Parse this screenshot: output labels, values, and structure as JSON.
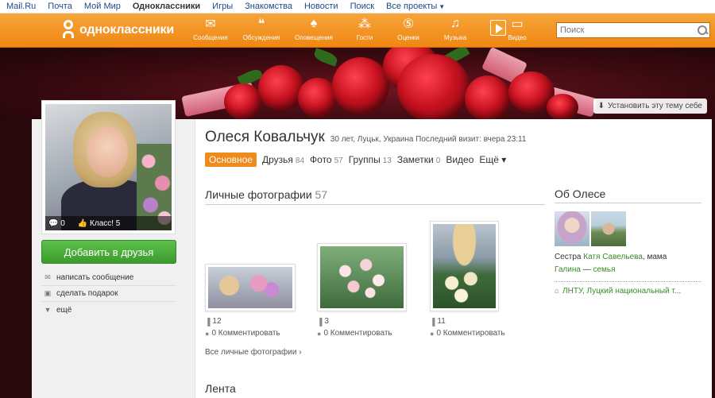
{
  "topbar": {
    "links": [
      "Mail.Ru",
      "Почта",
      "Мой Мир",
      "Одноклассники",
      "Игры",
      "Знакомства",
      "Новости",
      "Поиск",
      "Все проекты"
    ],
    "active": "Одноклассники"
  },
  "okbar": {
    "logo_text": "одноклассники",
    "nav": [
      {
        "label": "Сообщения",
        "icon": "envelope-icon",
        "glyph": "✉"
      },
      {
        "label": "Обсуждения",
        "icon": "chat-icon",
        "glyph": "💬"
      },
      {
        "label": "Оповещения",
        "icon": "bell-icon",
        "glyph": "🔔"
      },
      {
        "label": "Гости",
        "icon": "footprints-icon",
        "glyph": "👣"
      },
      {
        "label": "Оценки",
        "icon": "rating-icon",
        "glyph": "⑤"
      },
      {
        "label": "Музыка",
        "icon": "music-note-icon",
        "glyph": "♫"
      },
      {
        "label": "Видео",
        "icon": "video-icon",
        "glyph": "▭"
      }
    ],
    "search_placeholder": "Поиск"
  },
  "banner": {
    "theme_button": "Установить эту тему себе"
  },
  "profile": {
    "avatar_stats": {
      "comments": "0",
      "likes": "Класс! 5"
    },
    "add_friend": "Добавить в друзья",
    "actions": [
      {
        "label": "написать сообщение",
        "icon": "envelope-icon",
        "glyph": "✉"
      },
      {
        "label": "сделать подарок",
        "icon": "gift-icon",
        "glyph": "▣"
      },
      {
        "label": "ещё",
        "icon": "triangle-down-icon",
        "glyph": "▼"
      }
    ],
    "name": "Олеся Ковальчук",
    "meta": "30 лет, Луцьк, Украина  Последний визит: вчера 23:11"
  },
  "tabs": [
    {
      "label": "Основное",
      "count": ""
    },
    {
      "label": "Друзья",
      "count": "84"
    },
    {
      "label": "Фото",
      "count": "57"
    },
    {
      "label": "Группы",
      "count": "13"
    },
    {
      "label": "Заметки",
      "count": "0"
    },
    {
      "label": "Видео",
      "count": ""
    },
    {
      "label": "Ещё ▾",
      "count": ""
    }
  ],
  "photos": {
    "title": "Личные фотографии",
    "count": "57",
    "items": [
      {
        "views": "12",
        "comment": "0 Комментировать"
      },
      {
        "views": "3",
        "comment": "0 Комментировать"
      },
      {
        "views": "11",
        "comment": "0 Комментировать"
      }
    ],
    "all_link": "Все личные фотографии ›"
  },
  "about": {
    "title": "Об Олесе",
    "relation_prefix": "Сестра ",
    "sister": "Катя Савельева",
    "relation_mid": ", мама",
    "mother": "Галина",
    "relation_dash": " — ",
    "family": "семья",
    "education": "ЛНТУ, Луцкий национальный т..."
  },
  "feed": {
    "title": "Лента"
  }
}
